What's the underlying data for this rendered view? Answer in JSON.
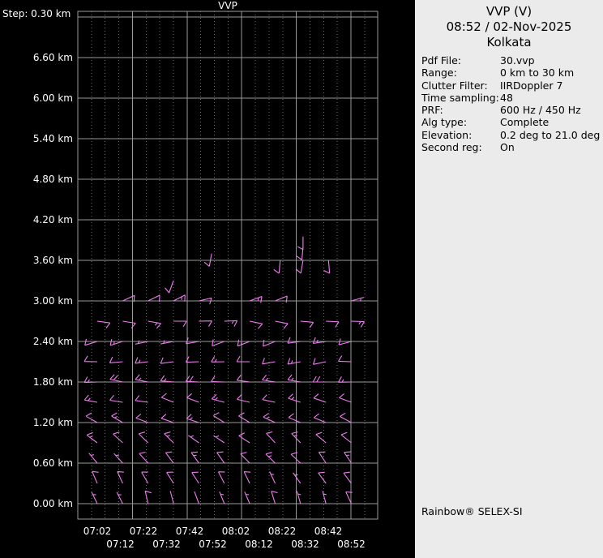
{
  "window": {
    "background": "#000000"
  },
  "panel": {
    "background": "#ebebeb",
    "title": "VVP (V)",
    "datetime": "08:52 / 02-Nov-2025",
    "site": "Kolkata",
    "params": [
      {
        "label": "Pdf File:",
        "value": "30.vvp"
      },
      {
        "label": "Range:",
        "value": "0 km to 30 km"
      },
      {
        "label": "Clutter Filter:",
        "value": "IIRDoppler 7"
      },
      {
        "label": "Time sampling:",
        "value": "48"
      },
      {
        "label": "PRF:",
        "value": "600 Hz / 450 Hz"
      },
      {
        "label": "Alg type:",
        "value": "Complete"
      },
      {
        "label": "Elevation:",
        "value": "0.2 deg to 21.0 deg"
      },
      {
        "label": "Second reg:",
        "value": "On"
      }
    ],
    "footer": "Rainbow® SELEX-SI"
  },
  "chart_data": {
    "type": "wind-barb-time-height",
    "title": "VVP",
    "step_label": "Step: 0.30 km",
    "y_unit": "km",
    "y_axis_range_km": [
      0.0,
      7.2
    ],
    "height_step_km": 0.3,
    "y_ticks": [
      {
        "label": "6.60 km",
        "km": 6.6
      },
      {
        "label": "6.00 km",
        "km": 6.0
      },
      {
        "label": "5.40 km",
        "km": 5.4
      },
      {
        "label": "4.80 km",
        "km": 4.8
      },
      {
        "label": "4.20 km",
        "km": 4.2
      },
      {
        "label": "3.60 km",
        "km": 3.6
      },
      {
        "label": "3.00 km",
        "km": 3.0
      },
      {
        "label": "2.40 km",
        "km": 2.4
      },
      {
        "label": "1.80 km",
        "km": 1.8
      },
      {
        "label": "1.20 km",
        "km": 1.2
      },
      {
        "label": "0.60 km",
        "km": 0.6
      },
      {
        "label": "0.00 km",
        "km": 0.0
      }
    ],
    "x_ticks_row1": [
      "07:02",
      "07:22",
      "07:42",
      "08:02",
      "08:22",
      "08:42"
    ],
    "x_ticks_row2": [
      "07:12",
      "07:32",
      "07:52",
      "08:12",
      "08:32",
      "08:52"
    ],
    "first_profile_time": "07:02",
    "profile_time_step_min": 11,
    "n_profiles": 11,
    "barb_color": "#f07df0",
    "grid_color": "#9a9a9a",
    "dot_grid_color": "#6e6e6e",
    "text_color": "#ffffff",
    "levels": [
      {
        "km": 0.0,
        "dir_deg": 340,
        "spd_kt": 5
      },
      {
        "km": 0.3,
        "dir_deg": 330,
        "spd_kt": 8
      },
      {
        "km": 0.6,
        "dir_deg": 320,
        "spd_kt": 10
      },
      {
        "km": 0.9,
        "dir_deg": 310,
        "spd_kt": 10
      },
      {
        "km": 1.2,
        "dir_deg": 295,
        "spd_kt": 12
      },
      {
        "km": 1.5,
        "dir_deg": 285,
        "spd_kt": 12
      },
      {
        "km": 1.8,
        "dir_deg": 275,
        "spd_kt": 15
      },
      {
        "km": 2.1,
        "dir_deg": 265,
        "spd_kt": 12
      },
      {
        "km": 2.4,
        "dir_deg": 255,
        "spd_kt": 10
      },
      {
        "km": 2.7,
        "dir_deg": 95,
        "spd_kt": 12
      },
      {
        "km": 3.0,
        "dir_deg": 70,
        "spd_kt": 10,
        "cols": [
          1,
          2,
          3,
          4,
          6,
          7,
          10
        ]
      }
    ],
    "dir_jitter": [
      -6,
      4,
      -2,
      7,
      -5,
      3,
      0,
      -7,
      5,
      -3,
      6
    ],
    "spd_jitter": [
      0,
      0,
      3,
      0,
      -3,
      0,
      3,
      0,
      0,
      -3,
      3
    ],
    "extra_barbs": [
      {
        "col": 3.0,
        "km": 3.3,
        "dir_deg": 200,
        "spd_kt": 10
      },
      {
        "col": 4.5,
        "km": 3.7,
        "dir_deg": 190,
        "spd_kt": 10
      },
      {
        "col": 7.2,
        "km": 3.6,
        "dir_deg": 185,
        "spd_kt": 10
      },
      {
        "col": 8.1,
        "km": 3.95,
        "dir_deg": 180,
        "spd_kt": 12
      },
      {
        "col": 8.1,
        "km": 3.8,
        "dir_deg": 185,
        "spd_kt": 10
      },
      {
        "col": 8.1,
        "km": 3.6,
        "dir_deg": 190,
        "spd_kt": 10
      },
      {
        "col": 9.1,
        "km": 3.6,
        "dir_deg": 175,
        "spd_kt": 8
      }
    ]
  }
}
